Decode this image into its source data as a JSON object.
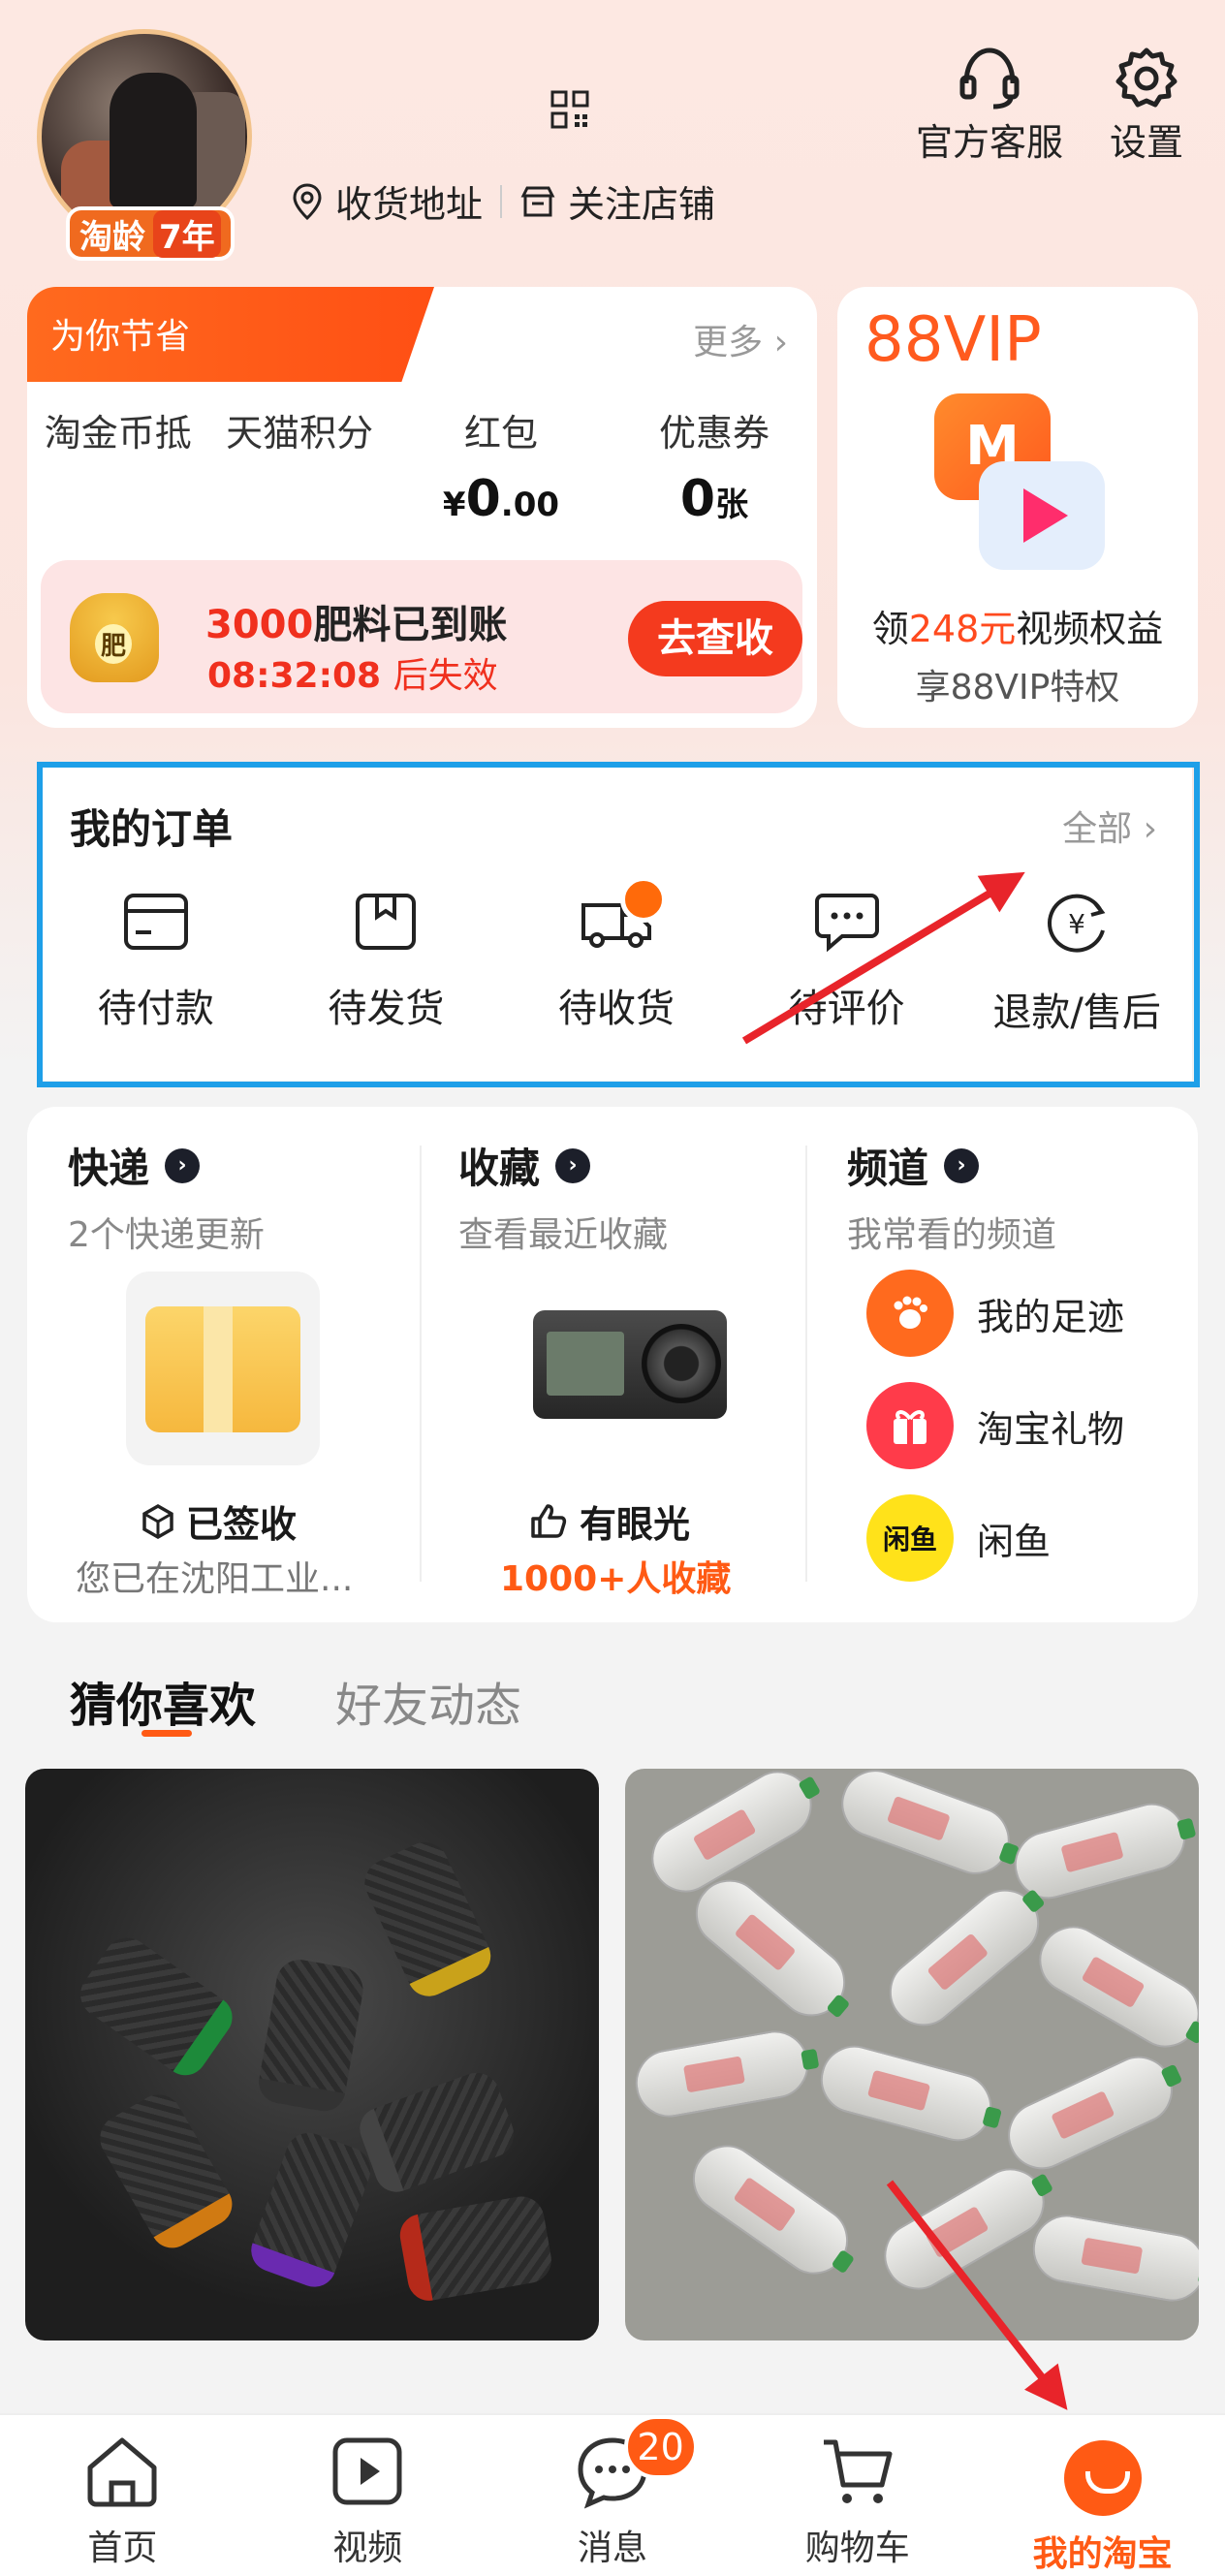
{
  "header": {
    "age_badge_label": "淘龄",
    "age_badge_years": "7年",
    "address_label": "收货地址",
    "follow_shops_label": "关注店铺",
    "customer_service_label": "官方客服",
    "settings_label": "设置"
  },
  "savings": {
    "tag": "为你节省",
    "more": "更多",
    "cols": [
      {
        "label": "淘金币抵",
        "value": "",
        "unit": ""
      },
      {
        "label": "天猫积分",
        "value": "",
        "unit": ""
      },
      {
        "label": "红包",
        "value_prefix": "¥",
        "value": "0",
        "value_suffix": ".00"
      },
      {
        "label": "优惠券",
        "value": "0",
        "unit": "张"
      }
    ],
    "fertilizer": {
      "amount": "3000",
      "title": "肥料已到账",
      "bag_label": "肥",
      "countdown": "08:32:08",
      "expire_text": "后失效",
      "button": "去查收"
    }
  },
  "vip": {
    "title": "88VIP",
    "line1_prefix": "领",
    "line1_highlight": "248元",
    "line1_suffix": "视频权益",
    "line2": "享88VIP特权"
  },
  "orders": {
    "title": "我的订单",
    "all": "全部",
    "items": [
      {
        "label": "待付款",
        "icon": "wallet-icon"
      },
      {
        "label": "待发货",
        "icon": "package-icon"
      },
      {
        "label": "待收货",
        "icon": "truck-icon"
      },
      {
        "label": "待评价",
        "icon": "chat-icon"
      },
      {
        "label": "退款/售后",
        "icon": "refund-icon"
      }
    ]
  },
  "services": {
    "express": {
      "title": "快递",
      "subtitle": "2个快递更新",
      "status": "已签收",
      "note": "您已在沈阳工业..."
    },
    "favorites": {
      "title": "收藏",
      "subtitle": "查看最近收藏",
      "status": "有眼光",
      "note": "1000+人收藏"
    },
    "channels": {
      "title": "频道",
      "subtitle": "我常看的频道",
      "items": [
        {
          "label": "我的足迹",
          "icon": "footprint-icon",
          "color": "#ff6a1e"
        },
        {
          "label": "淘宝礼物",
          "icon": "gift-icon",
          "color": "#ff3b4a"
        },
        {
          "label": "闲鱼",
          "icon": "xianyu-icon",
          "color": "#ffe21a",
          "glyph": "闲鱼"
        }
      ]
    }
  },
  "feed_tabs": {
    "guess": "猜你喜欢",
    "friends": "好友动态"
  },
  "colors": {
    "accent": "#ff5a14",
    "highlight_frame": "#1e9fe8",
    "arrow": "#e8242a"
  },
  "bottom_nav": {
    "items": [
      {
        "label": "首页",
        "icon": "home-icon"
      },
      {
        "label": "视频",
        "icon": "video-icon"
      },
      {
        "label": "消息",
        "icon": "message-icon",
        "badge": "20"
      },
      {
        "label": "购物车",
        "icon": "cart-icon"
      },
      {
        "label": "我的淘宝",
        "icon": "my-taobao-icon",
        "active": true
      }
    ]
  }
}
